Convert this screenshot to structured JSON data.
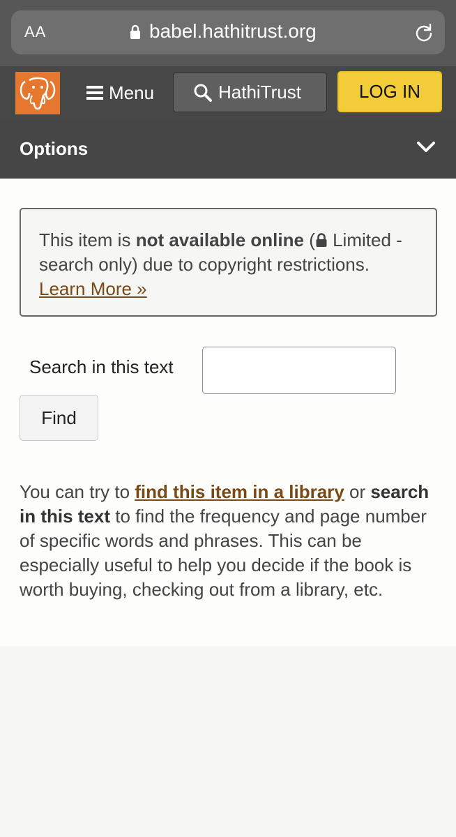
{
  "browser": {
    "aa_label": "AA",
    "url": "babel.hathitrust.org"
  },
  "header": {
    "menu_label": "Menu",
    "search_label": "HathiTrust",
    "login_label": "LOG IN"
  },
  "options": {
    "title": "Options"
  },
  "notice": {
    "prefix": "This item is ",
    "bold": "not available online",
    "paren_open": " (",
    "middle": " Limited - search only) due to copyright restrictions. ",
    "link": "Learn More »"
  },
  "search": {
    "label": "Search in this text",
    "input_value": "",
    "find_label": "Find"
  },
  "body": {
    "prefix": "You can try to ",
    "link": "find this item in a library",
    "mid": " or ",
    "bold": "search in this text",
    "suffix": " to find the frequency and page number of specific words and phrases. This can be especially useful to help you decide if the book is worth buying, checking out from a library, etc."
  },
  "colors": {
    "header_bg": "#474747",
    "login_bg": "#f3cc3a",
    "logo_bg": "#e6772e",
    "link": "#7a4a16"
  },
  "icons": [
    "lock-icon",
    "reload-icon",
    "hamburger-icon",
    "search-icon",
    "chevron-down-icon",
    "elephant-logo-icon"
  ]
}
